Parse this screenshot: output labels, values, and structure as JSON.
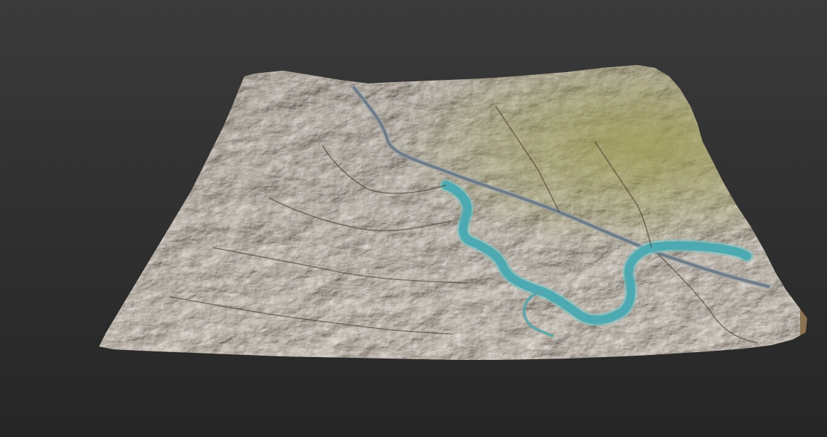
{
  "scene": {
    "background": {
      "top": "#3a3a3a",
      "bottom": "#262626"
    },
    "terrain": {
      "base_color": "#8a7352",
      "highlight_color": "#b39a72",
      "shadow_color": "#4a3a2a",
      "vegetation_color": "#9a9a55"
    },
    "river": {
      "color": "#4eaab2",
      "edge_color": "#7fc4c4"
    },
    "road": {
      "color": "#6f7b86",
      "edge_color": "#9aa6ae"
    }
  }
}
